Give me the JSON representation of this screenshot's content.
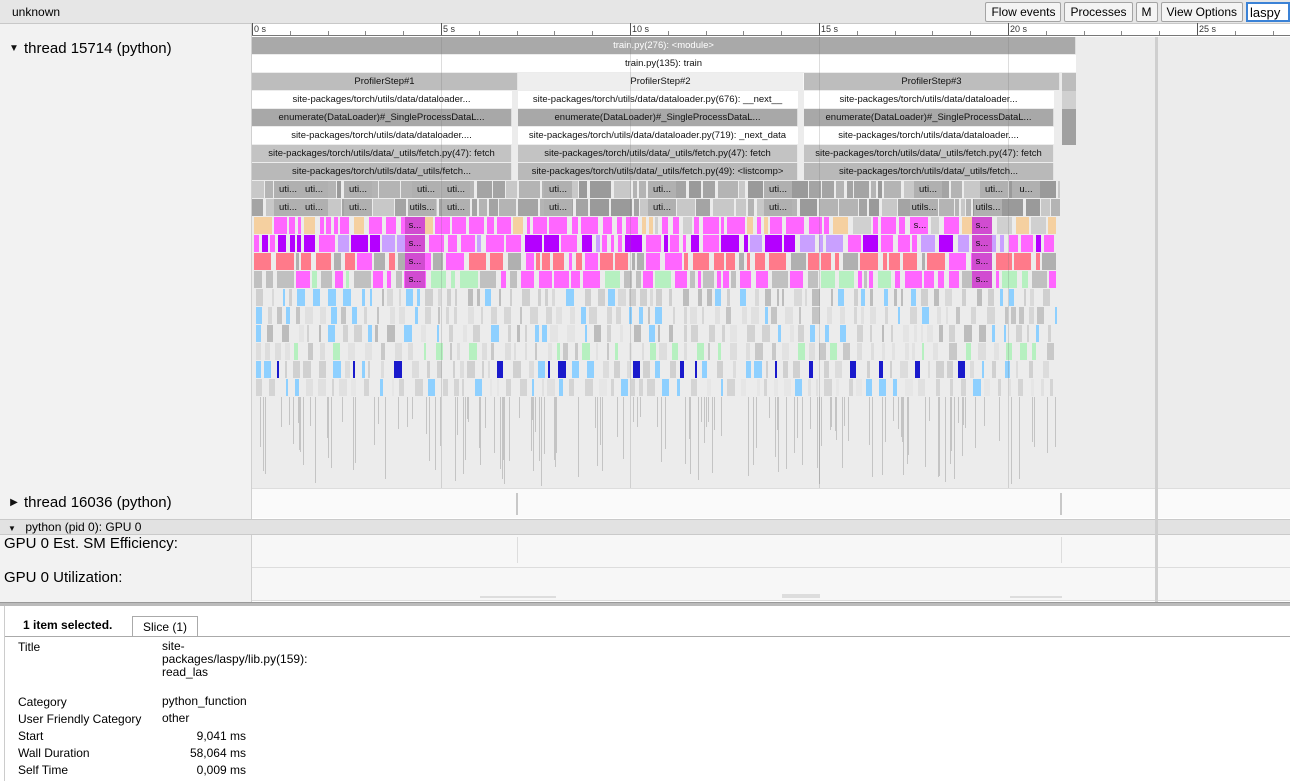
{
  "app": {
    "title": "unknown"
  },
  "toolbar": {
    "flow_events": "Flow events",
    "processes": "Processes",
    "m": "M",
    "view_options": "View Options",
    "search_value": "laspy"
  },
  "ruler": {
    "labels": [
      "0 s",
      "5 s",
      "10 s",
      "15 s",
      "20 s",
      "25 s"
    ]
  },
  "threads": [
    {
      "label": "thread 15714 (python)",
      "expanded": true
    },
    {
      "label": "thread 16036 (python)",
      "expanded": false
    }
  ],
  "process_group": "python (pid 0): GPU 0",
  "counters": [
    {
      "label": "GPU 0 Est. SM Efficiency:"
    },
    {
      "label": "GPU 0 Utilization:"
    }
  ],
  "slices": {
    "module": "train.py(276): <module>",
    "train": "train.py(135): train",
    "steps": [
      "ProfilerStep#1",
      "ProfilerStep#2",
      "ProfilerStep#3"
    ],
    "next": [
      "site-packages/torch/utils/data/dataloader...",
      "site-packages/torch/utils/data/dataloader.py(676): __next__",
      "site-packages/torch/utils/data/dataloader..."
    ],
    "enumerate": [
      "enumerate(DataLoader)#_SingleProcessDataL...",
      "enumerate(DataLoader)#_SingleProcessDataL...",
      "enumerate(DataLoader)#_SingleProcessDataL..."
    ],
    "next_data": [
      "site-packages/torch/utils/data/dataloader....",
      "site-packages/torch/utils/data/dataloader.py(719): _next_data",
      "site-packages/torch/utils/data/dataloader...."
    ],
    "fetch": [
      "site-packages/torch/utils/data/_utils/fetch.py(47): fetch",
      "site-packages/torch/utils/data/_utils/fetch.py(47): fetch",
      "site-packages/torch/utils/data/_utils/fetch.py(47): fetch"
    ],
    "listcomp": [
      "site-packages/torch/utils/data/_utils/fetch...",
      "site-packages/torch/utils/data/_utils/fetch.py(49): <listcomp>",
      "site-packages/torch/utils/data/_utils/fetch..."
    ],
    "uti": "uti...",
    "utils": "utils...",
    "u": "u...",
    "s": "s..."
  },
  "colors": {
    "magenta": "#ff66ff",
    "purple": "#b400ff",
    "salmon": "#ff7a8a",
    "blue": "#1a1acc",
    "lightblue": "#8ed0ff",
    "peach": "#f5d0a0",
    "mint": "#b6f0c0"
  },
  "details": {
    "summary": "1 item selected.",
    "tab": "Slice (1)",
    "rows": [
      {
        "key": "Title",
        "value": "site-packages/laspy/lib.py(159): read_las"
      },
      {
        "key": "Category",
        "value": "python_function"
      },
      {
        "key": "User Friendly Category",
        "value": "other"
      },
      {
        "key": "Start",
        "value": "9,041 ms"
      },
      {
        "key": "Wall Duration",
        "value": "58,064 ms"
      },
      {
        "key": "Self Time",
        "value": "0,009 ms"
      }
    ]
  }
}
